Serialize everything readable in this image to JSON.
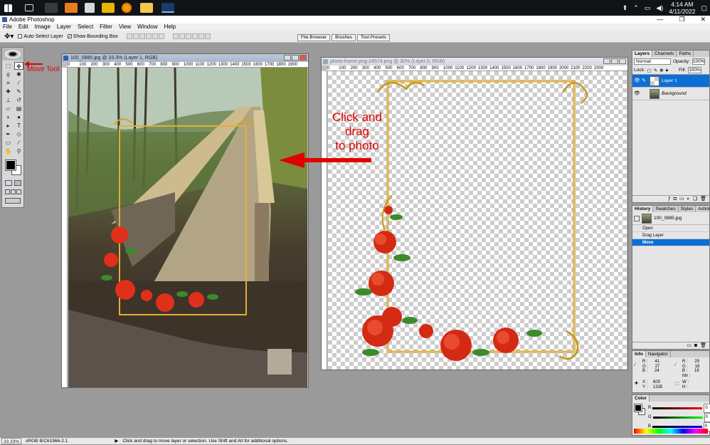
{
  "taskbar": {
    "clock_time": "4:14 AM",
    "clock_date": "4/11/2022",
    "icons": [
      "windows-start-icon",
      "task-view-icon",
      "media-player-icon",
      "3d-viewer-icon",
      "game-icon",
      "firefox-icon",
      "file-explorer-icon",
      "photoshop-icon"
    ]
  },
  "app": {
    "title": "Adobe Photoshop",
    "menu": [
      "File",
      "Edit",
      "Image",
      "Layer",
      "Select",
      "Filter",
      "View",
      "Window",
      "Help"
    ]
  },
  "options": {
    "auto_select": "Auto Select Layer",
    "show_bounding": "Show Bounding Box"
  },
  "palette_well": [
    "File Browser",
    "Brushes",
    "Tool Presets"
  ],
  "annotations": {
    "move_tool": "Move Tool",
    "click_drag_1": "Click and",
    "click_drag_2": "drag",
    "click_drag_3": "to photo",
    "color": "#e00000"
  },
  "doc1": {
    "title": "100_0885.jpg @ 33.3% (Layer 1, RGB)",
    "ruler": [
      "0",
      "100",
      "200",
      "300",
      "400",
      "500",
      "600",
      "700",
      "800",
      "900",
      "1000",
      "1100",
      "1200",
      "1300",
      "1400",
      "1500",
      "1600",
      "1700",
      "1800",
      "1900"
    ]
  },
  "doc2": {
    "title": "photo-frame-png-24574.png @ 30% (Layer 0, RGB)",
    "ruler": [
      "0",
      "100",
      "200",
      "300",
      "400",
      "500",
      "600",
      "700",
      "800",
      "900",
      "1000",
      "1100",
      "1200",
      "1300",
      "1400",
      "1500",
      "1600",
      "1700",
      "1800",
      "1900",
      "2000",
      "2100",
      "2200",
      "2300"
    ]
  },
  "layers": {
    "tabs": [
      "Layers",
      "Channels",
      "Paths"
    ],
    "blend": "Normal",
    "opacity_label": "Opacity:",
    "opacity": "100%",
    "lock_label": "Lock:",
    "fill_label": "Fill:",
    "fill": "100%",
    "items": [
      "Layer 1",
      "Background"
    ]
  },
  "history": {
    "tabs": [
      "History",
      "Swatches",
      "Styles",
      "Actions"
    ],
    "snapshot": "100_0885.jpg",
    "items": [
      "Open",
      "Drag Layer",
      "Move"
    ]
  },
  "info": {
    "tabs": [
      "Info",
      "Navigator"
    ],
    "r1": "41",
    "g1": "27",
    "b1": "24",
    "r2": "29",
    "g2": "18",
    "b2": "18",
    "x": "600",
    "y": "1335",
    "labels": {
      "r": "R :",
      "g": "G :",
      "b": "B :",
      "x": "X :",
      "y": "Y :",
      "w": "W :",
      "h": "H :",
      "idx": "Idx :"
    }
  },
  "color_panel": {
    "tab": "Color",
    "r": "0",
    "g": "0",
    "b": "0"
  },
  "status": {
    "zoom": "33.33%",
    "profile": "sRGB IEC61966-2.1",
    "hint": "Click and drag to move layer or selection. Use Shift and Alt for additional options."
  }
}
